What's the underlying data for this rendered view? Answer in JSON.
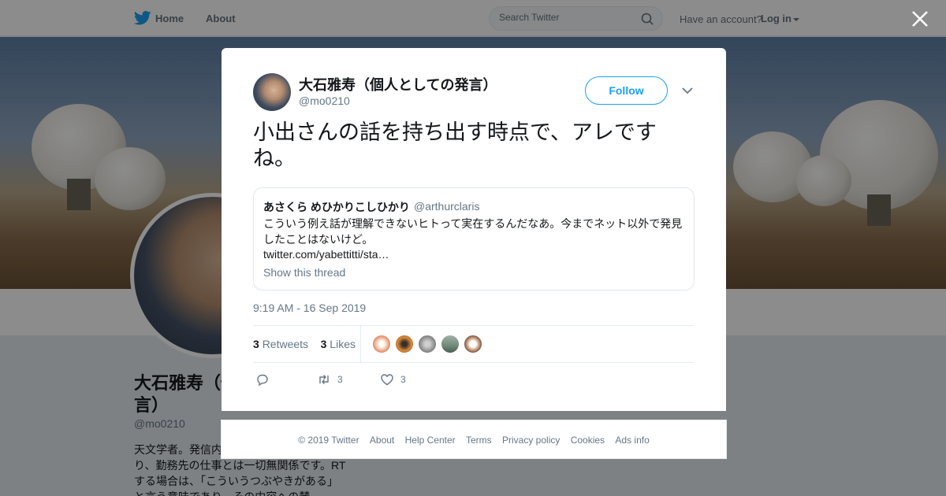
{
  "nav": {
    "home_label": "Home",
    "about_label": "About",
    "search_placeholder": "Search Twitter",
    "have_account": "Have an account?",
    "login_label": "Log in"
  },
  "profile": {
    "name": "大石雅寿（個人としての発言）",
    "handle": "@mo0210",
    "bio": "天文学者。発信内容は個人的なものであり、勤務先の仕事とは一切無関係です。RTする場合は、「こういうつぶやきがある」と言う意味であり、その内容への賛"
  },
  "tweet": {
    "author_name": "大石雅寿（個人としての発言）",
    "author_handle": "@mo0210",
    "follow_label": "Follow",
    "text": "小出さんの話を持ち出す時点で、アレですね。",
    "quoted": {
      "name": "あさくら めひかりこしひかり",
      "handle": "@arthurclaris",
      "text": "こういう例え話が理解できないヒトって実在するんだなあ。今までネット以外で発見したことはないけど。",
      "link": "twitter.com/yabettitti/sta…",
      "thread_label": "Show this thread"
    },
    "timestamp": "9:19 AM - 16 Sep 2019",
    "retweets_count": "3",
    "retweets_label": "Retweets",
    "likes_count": "3",
    "likes_label": "Likes",
    "action_retweet_count": "3",
    "action_like_count": "3"
  },
  "footer": {
    "copyright": "© 2019 Twitter",
    "about": "About",
    "help": "Help Center",
    "terms": "Terms",
    "privacy": "Privacy policy",
    "cookies": "Cookies",
    "ads": "Ads info"
  },
  "colors": {
    "accent": "#1da1f2",
    "text_secondary": "#657786",
    "overlay": "rgba(0,0,0,0.45)"
  },
  "icons": [
    "twitter-bird-icon",
    "search-icon",
    "caret-down-icon",
    "close-icon",
    "chevron-down-icon",
    "reply-icon",
    "retweet-icon",
    "like-icon"
  ]
}
